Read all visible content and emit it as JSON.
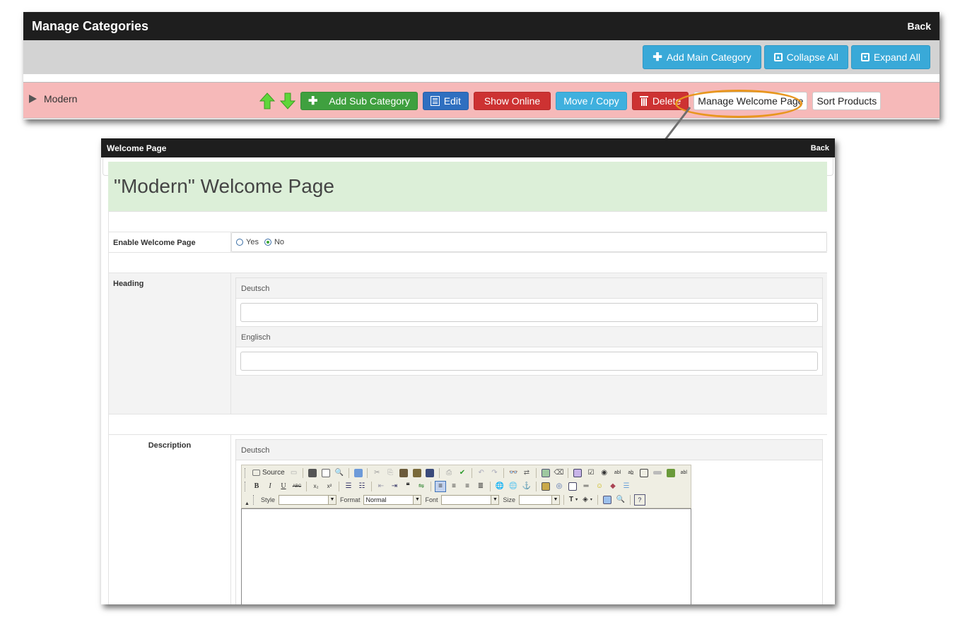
{
  "manage_categories": {
    "title": "Manage Categories",
    "back_label": "Back",
    "toolbar": {
      "add_main_category": "Add Main Category",
      "collapse_all": "Collapse All",
      "expand_all": "Expand All"
    },
    "category_row": {
      "name": "Modern",
      "actions": {
        "add_sub_category": "Add Sub Category",
        "edit": "Edit",
        "show_online": "Show Online",
        "move_copy": "Move / Copy",
        "delete": "Delete",
        "manage_welcome_page": "Manage Welcome Page",
        "sort_products": "Sort Products"
      },
      "highlighted_action": "Manage Welcome Page"
    }
  },
  "welcome_page": {
    "title": "Welcome Page",
    "back_label": "Back",
    "heading": "\"Modern\" Welcome Page",
    "enable": {
      "label": "Enable Welcome Page",
      "options": [
        "Yes",
        "No"
      ],
      "selected": "No"
    },
    "heading_field": {
      "label": "Heading",
      "languages": [
        {
          "name": "Deutsch",
          "value": ""
        },
        {
          "name": "Englisch",
          "value": ""
        }
      ]
    },
    "description_field": {
      "label": "Description",
      "language": "Deutsch",
      "editor": {
        "source_label": "Source",
        "style_label": "Style",
        "style_value": "",
        "format_label": "Format",
        "format_value": "Normal",
        "font_label": "Font",
        "font_value": "",
        "size_label": "Size",
        "size_value": "",
        "content": ""
      }
    }
  },
  "colors": {
    "titlebar": "#1e1e1e",
    "category_row_bg": "#f6b9b9",
    "info": "#39a9d8",
    "success": "#3fa03f",
    "primary": "#2f6fc0",
    "danger": "#cd3232",
    "heading_bg": "#dcefd8",
    "highlight": "#e8961e"
  }
}
